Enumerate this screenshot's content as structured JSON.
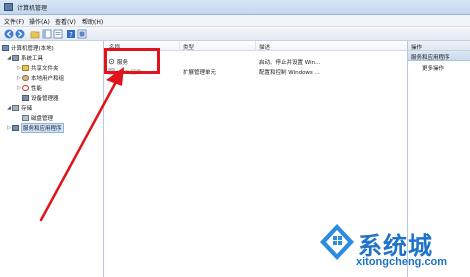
{
  "window": {
    "title": "计算机管理"
  },
  "menu": [
    {
      "label": "文件(F)"
    },
    {
      "label": "操作(A)"
    },
    {
      "label": "查看(V)"
    },
    {
      "label": "帮助(H)"
    }
  ],
  "tree": [
    {
      "label": "计算机管理(本地)",
      "icon": "computer-management-icon"
    },
    {
      "label": "系统工具",
      "icon": "tools-icon"
    },
    {
      "label": "共享文件夹",
      "icon": "shared-folder-icon"
    },
    {
      "label": "本地用户和组",
      "icon": "users-icon"
    },
    {
      "label": "性能",
      "icon": "performance-icon"
    },
    {
      "label": "设备管理器",
      "icon": "device-manager-icon"
    },
    {
      "label": "存储",
      "icon": "storage-icon"
    },
    {
      "label": "磁盘管理",
      "icon": "disk-management-icon"
    },
    {
      "label": "服务和应用程序",
      "icon": "services-apps-icon"
    }
  ],
  "list": {
    "columns": [
      "名称",
      "类型",
      "描述"
    ],
    "rows": [
      {
        "name": "服务",
        "type": "",
        "desc": "启动、停止并设置 Win...",
        "icon": "services-gear-icon"
      },
      {
        "name": "WMI 控件",
        "type": "扩展管理单元",
        "desc": "配置和控制 Windows ...",
        "icon": "wmi-icon"
      }
    ]
  },
  "actions": {
    "header": "操作",
    "section": "服务和应用程序",
    "items": [
      "更多操作"
    ]
  },
  "watermark": {
    "title": "系统城",
    "url": "xitongcheng.com"
  },
  "colors": {
    "highlight": "#e0141a",
    "brand": "#1f73c9"
  }
}
